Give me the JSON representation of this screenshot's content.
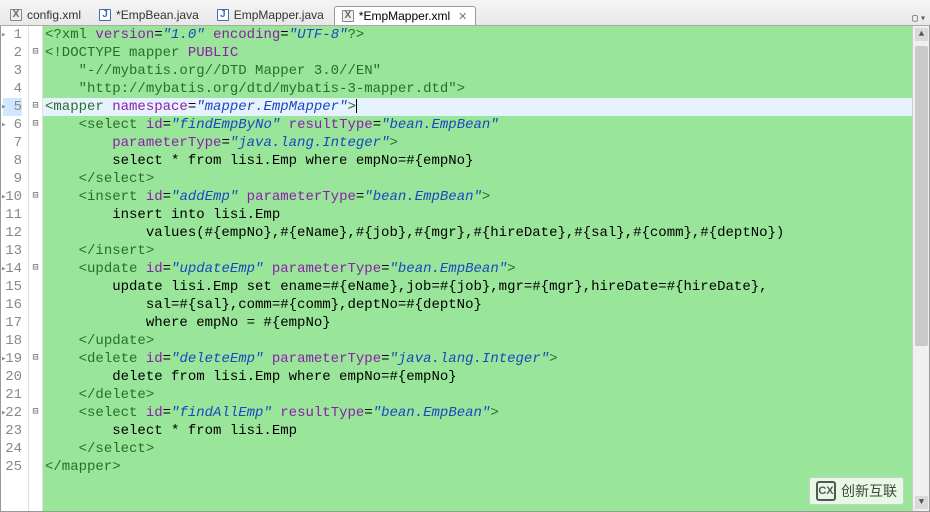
{
  "tabs": [
    {
      "icon": "x",
      "label": "config.xml",
      "dirty": false,
      "active": false
    },
    {
      "icon": "j",
      "label": "*EmpBean.java",
      "dirty": true,
      "active": false
    },
    {
      "icon": "j",
      "label": "EmpMapper.java",
      "dirty": false,
      "active": false
    },
    {
      "icon": "x",
      "label": "*EmpMapper.xml",
      "dirty": true,
      "active": true
    }
  ],
  "code": {
    "current_line": 5,
    "lines": [
      {
        "n": 1,
        "marked": true,
        "fold": "",
        "tokens": [
          {
            "t": "<?",
            "c": "pi"
          },
          {
            "t": "xml ",
            "c": "pi"
          },
          {
            "t": "version",
            "c": "attr"
          },
          {
            "t": "=",
            "c": "txt"
          },
          {
            "t": "\"1.0\"",
            "c": "str"
          },
          {
            "t": " ",
            "c": "txt"
          },
          {
            "t": "encoding",
            "c": "attr"
          },
          {
            "t": "=",
            "c": "txt"
          },
          {
            "t": "\"UTF-8\"",
            "c": "str"
          },
          {
            "t": "?>",
            "c": "pi"
          }
        ]
      },
      {
        "n": 2,
        "marked": false,
        "fold": "minus",
        "tokens": [
          {
            "t": "<!DOCTYPE ",
            "c": "doctype"
          },
          {
            "t": "mapper ",
            "c": "doctype"
          },
          {
            "t": "PUBLIC",
            "c": "pub"
          }
        ]
      },
      {
        "n": 3,
        "marked": false,
        "fold": "",
        "tokens": [
          {
            "t": "    ",
            "c": "txt"
          },
          {
            "t": "\"-//mybatis.org//DTD Mapper 3.0//EN\"",
            "c": "doctype"
          }
        ]
      },
      {
        "n": 4,
        "marked": false,
        "fold": "",
        "tokens": [
          {
            "t": "    ",
            "c": "txt"
          },
          {
            "t": "\"http://mybatis.org/dtd/mybatis-3-mapper.dtd\"",
            "c": "doctype"
          },
          {
            "t": ">",
            "c": "doctype"
          }
        ]
      },
      {
        "n": 5,
        "marked": true,
        "fold": "minus",
        "highlight": true,
        "cursor": true,
        "tokens": [
          {
            "t": "<",
            "c": "tagc"
          },
          {
            "t": "mapper ",
            "c": "tagc"
          },
          {
            "t": "namespace",
            "c": "attr"
          },
          {
            "t": "=",
            "c": "txt"
          },
          {
            "t": "\"mapper.EmpMapper\"",
            "c": "str"
          },
          {
            "t": ">",
            "c": "tagc"
          }
        ]
      },
      {
        "n": 6,
        "marked": true,
        "fold": "minus",
        "tokens": [
          {
            "t": "    ",
            "c": "txt"
          },
          {
            "t": "<",
            "c": "tagc"
          },
          {
            "t": "select ",
            "c": "tagc"
          },
          {
            "t": "id",
            "c": "attr"
          },
          {
            "t": "=",
            "c": "txt"
          },
          {
            "t": "\"findEmpByNo\"",
            "c": "str"
          },
          {
            "t": " ",
            "c": "txt"
          },
          {
            "t": "resultType",
            "c": "attr"
          },
          {
            "t": "=",
            "c": "txt"
          },
          {
            "t": "\"bean.EmpBean\"",
            "c": "str"
          }
        ]
      },
      {
        "n": 7,
        "marked": false,
        "fold": "",
        "tokens": [
          {
            "t": "        ",
            "c": "txt"
          },
          {
            "t": "parameterType",
            "c": "attr"
          },
          {
            "t": "=",
            "c": "txt"
          },
          {
            "t": "\"java.lang.Integer\"",
            "c": "str"
          },
          {
            "t": ">",
            "c": "tagc"
          }
        ]
      },
      {
        "n": 8,
        "marked": false,
        "fold": "",
        "tokens": [
          {
            "t": "        select * from lisi.Emp where empNo=#{empNo}",
            "c": "txt"
          }
        ]
      },
      {
        "n": 9,
        "marked": false,
        "fold": "",
        "tokens": [
          {
            "t": "    ",
            "c": "txt"
          },
          {
            "t": "</select>",
            "c": "tagc"
          }
        ]
      },
      {
        "n": 10,
        "marked": true,
        "fold": "minus",
        "tokens": [
          {
            "t": "    ",
            "c": "txt"
          },
          {
            "t": "<",
            "c": "tagc"
          },
          {
            "t": "insert ",
            "c": "tagc"
          },
          {
            "t": "id",
            "c": "attr"
          },
          {
            "t": "=",
            "c": "txt"
          },
          {
            "t": "\"addEmp\"",
            "c": "str"
          },
          {
            "t": " ",
            "c": "txt"
          },
          {
            "t": "parameterType",
            "c": "attr"
          },
          {
            "t": "=",
            "c": "txt"
          },
          {
            "t": "\"bean.EmpBean\"",
            "c": "str"
          },
          {
            "t": ">",
            "c": "tagc"
          }
        ]
      },
      {
        "n": 11,
        "marked": false,
        "fold": "",
        "tokens": [
          {
            "t": "        insert into lisi.Emp",
            "c": "txt"
          }
        ]
      },
      {
        "n": 12,
        "marked": false,
        "fold": "",
        "tokens": [
          {
            "t": "            values(#{empNo},#{eName},#{job},#{mgr},#{hireDate},#{sal},#{comm},#{deptNo})",
            "c": "txt"
          }
        ]
      },
      {
        "n": 13,
        "marked": false,
        "fold": "",
        "tokens": [
          {
            "t": "    ",
            "c": "txt"
          },
          {
            "t": "</insert>",
            "c": "tagc"
          }
        ]
      },
      {
        "n": 14,
        "marked": true,
        "fold": "minus",
        "tokens": [
          {
            "t": "    ",
            "c": "txt"
          },
          {
            "t": "<",
            "c": "tagc"
          },
          {
            "t": "update ",
            "c": "tagc"
          },
          {
            "t": "id",
            "c": "attr"
          },
          {
            "t": "=",
            "c": "txt"
          },
          {
            "t": "\"updateEmp\"",
            "c": "str"
          },
          {
            "t": " ",
            "c": "txt"
          },
          {
            "t": "parameterType",
            "c": "attr"
          },
          {
            "t": "=",
            "c": "txt"
          },
          {
            "t": "\"bean.EmpBean\"",
            "c": "str"
          },
          {
            "t": ">",
            "c": "tagc"
          }
        ]
      },
      {
        "n": 15,
        "marked": false,
        "fold": "",
        "tokens": [
          {
            "t": "        update lisi.Emp set ename=#{eName},job=#{job},mgr=#{mgr},hireDate=#{hireDate},",
            "c": "txt"
          }
        ]
      },
      {
        "n": 16,
        "marked": false,
        "fold": "",
        "tokens": [
          {
            "t": "            sal=#{sal},comm=#{comm},deptNo=#{deptNo}",
            "c": "txt"
          }
        ]
      },
      {
        "n": 17,
        "marked": false,
        "fold": "",
        "tokens": [
          {
            "t": "            where empNo = #{empNo}",
            "c": "txt"
          }
        ]
      },
      {
        "n": 18,
        "marked": false,
        "fold": "",
        "tokens": [
          {
            "t": "    ",
            "c": "txt"
          },
          {
            "t": "</update>",
            "c": "tagc"
          }
        ]
      },
      {
        "n": 19,
        "marked": true,
        "fold": "minus",
        "tokens": [
          {
            "t": "    ",
            "c": "txt"
          },
          {
            "t": "<",
            "c": "tagc"
          },
          {
            "t": "delete ",
            "c": "tagc"
          },
          {
            "t": "id",
            "c": "attr"
          },
          {
            "t": "=",
            "c": "txt"
          },
          {
            "t": "\"deleteEmp\"",
            "c": "str"
          },
          {
            "t": " ",
            "c": "txt"
          },
          {
            "t": "parameterType",
            "c": "attr"
          },
          {
            "t": "=",
            "c": "txt"
          },
          {
            "t": "\"java.lang.Integer\"",
            "c": "str"
          },
          {
            "t": ">",
            "c": "tagc"
          }
        ]
      },
      {
        "n": 20,
        "marked": false,
        "fold": "",
        "tokens": [
          {
            "t": "        delete from lisi.Emp where empNo=#{empNo}",
            "c": "txt"
          }
        ]
      },
      {
        "n": 21,
        "marked": false,
        "fold": "",
        "tokens": [
          {
            "t": "    ",
            "c": "txt"
          },
          {
            "t": "</delete>",
            "c": "tagc"
          }
        ]
      },
      {
        "n": 22,
        "marked": true,
        "fold": "minus",
        "tokens": [
          {
            "t": "    ",
            "c": "txt"
          },
          {
            "t": "<",
            "c": "tagc"
          },
          {
            "t": "select ",
            "c": "tagc"
          },
          {
            "t": "id",
            "c": "attr"
          },
          {
            "t": "=",
            "c": "txt"
          },
          {
            "t": "\"findAllEmp\"",
            "c": "str"
          },
          {
            "t": " ",
            "c": "txt"
          },
          {
            "t": "resultType",
            "c": "attr"
          },
          {
            "t": "=",
            "c": "txt"
          },
          {
            "t": "\"bean.EmpBean\"",
            "c": "str"
          },
          {
            "t": ">",
            "c": "tagc"
          }
        ]
      },
      {
        "n": 23,
        "marked": false,
        "fold": "",
        "tokens": [
          {
            "t": "        select * from lisi.Emp",
            "c": "txt"
          }
        ]
      },
      {
        "n": 24,
        "marked": false,
        "fold": "",
        "tokens": [
          {
            "t": "    ",
            "c": "txt"
          },
          {
            "t": "</select>",
            "c": "tagc"
          }
        ]
      },
      {
        "n": 25,
        "marked": false,
        "fold": "",
        "tokens": [
          {
            "t": "</mapper>",
            "c": "tagc"
          }
        ]
      }
    ]
  },
  "watermark": "创新互联"
}
